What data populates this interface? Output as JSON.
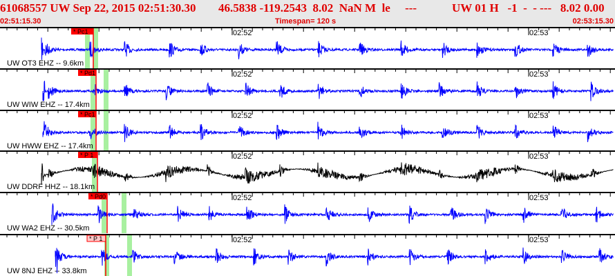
{
  "header": {
    "event": "61068557 UW Sep 22, 2015 02:51:30.30",
    "location": "46.5838 -119.2543  8.02  NaN M  le     ---",
    "source": "UW 01 H   -1  -  - ---   8.02 0.00",
    "start_time": "02:51:15.30",
    "timespan": "Timespan= 120 s",
    "end_time": "02:53:15.30"
  },
  "time_ticks": [
    "02:52",
    "02:53"
  ],
  "colors": {
    "header_text": "#e00000",
    "trace": "#0000ff",
    "trace_alt": "#000000",
    "pick": "#ff0000",
    "window": "#a8f0a0"
  },
  "panels": [
    {
      "label": "UW OT3 EHZ -- 9.6km",
      "pick": "* Pc1",
      "trace_color": "#0000ff",
      "pick_style": "solid"
    },
    {
      "label": "UW WIW EHZ -- 17.4km",
      "pick": "* Pd1",
      "trace_color": "#0000ff",
      "pick_style": "solid"
    },
    {
      "label": "UW HWW EHZ -- 17.4km",
      "pick": "* Pc1",
      "trace_color": "#0000ff",
      "pick_style": "solid"
    },
    {
      "label": "UW DDRF HHZ -- 18.1km",
      "pick": "* P 1",
      "trace_color": "#000000",
      "pick_style": "solid"
    },
    {
      "label": "UW WA2 EHZ -- 30.5km",
      "pick": "* Pd0",
      "trace_color": "#0000ff",
      "pick_style": "solid"
    },
    {
      "label": "UW 8NJ EHZ -- 33.8km",
      "pick": "* P 1",
      "trace_color": "#0000ff",
      "pick_style": "light"
    }
  ]
}
